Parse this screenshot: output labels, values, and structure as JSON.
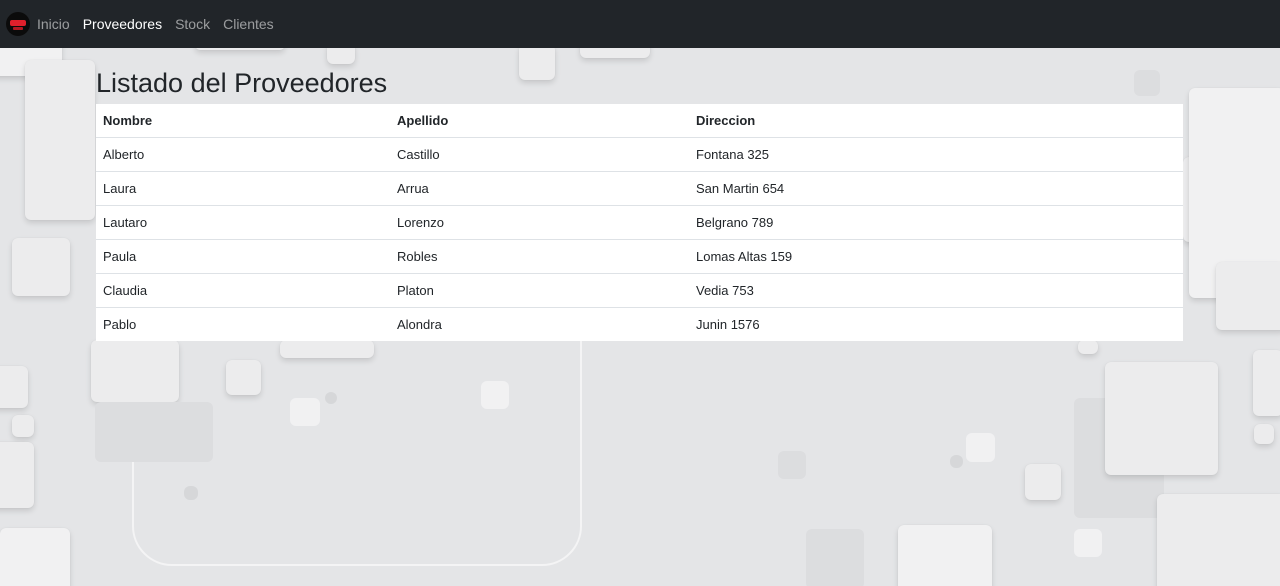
{
  "navbar": {
    "brand_icon": "brand-logo-icon",
    "links": [
      {
        "label": "Inicio",
        "active": false
      },
      {
        "label": "Proveedores",
        "active": true
      },
      {
        "label": "Stock",
        "active": false
      },
      {
        "label": "Clientes",
        "active": false
      }
    ],
    "background": "#212529"
  },
  "page": {
    "title": "Listado del Proveedores"
  },
  "table": {
    "headers": [
      "Nombre",
      "Apellido",
      "Direccion"
    ],
    "rows": [
      [
        "Alberto",
        "Castillo",
        "Fontana 325"
      ],
      [
        "Laura",
        "Arrua",
        "San Martin 654"
      ],
      [
        "Lautaro",
        "Lorenzo",
        "Belgrano 789"
      ],
      [
        "Paula",
        "Robles",
        "Lomas Altas 159"
      ],
      [
        "Claudia",
        "Platon",
        "Vedia 753"
      ],
      [
        "Pablo",
        "Alondra",
        "Junin 1576"
      ]
    ]
  }
}
